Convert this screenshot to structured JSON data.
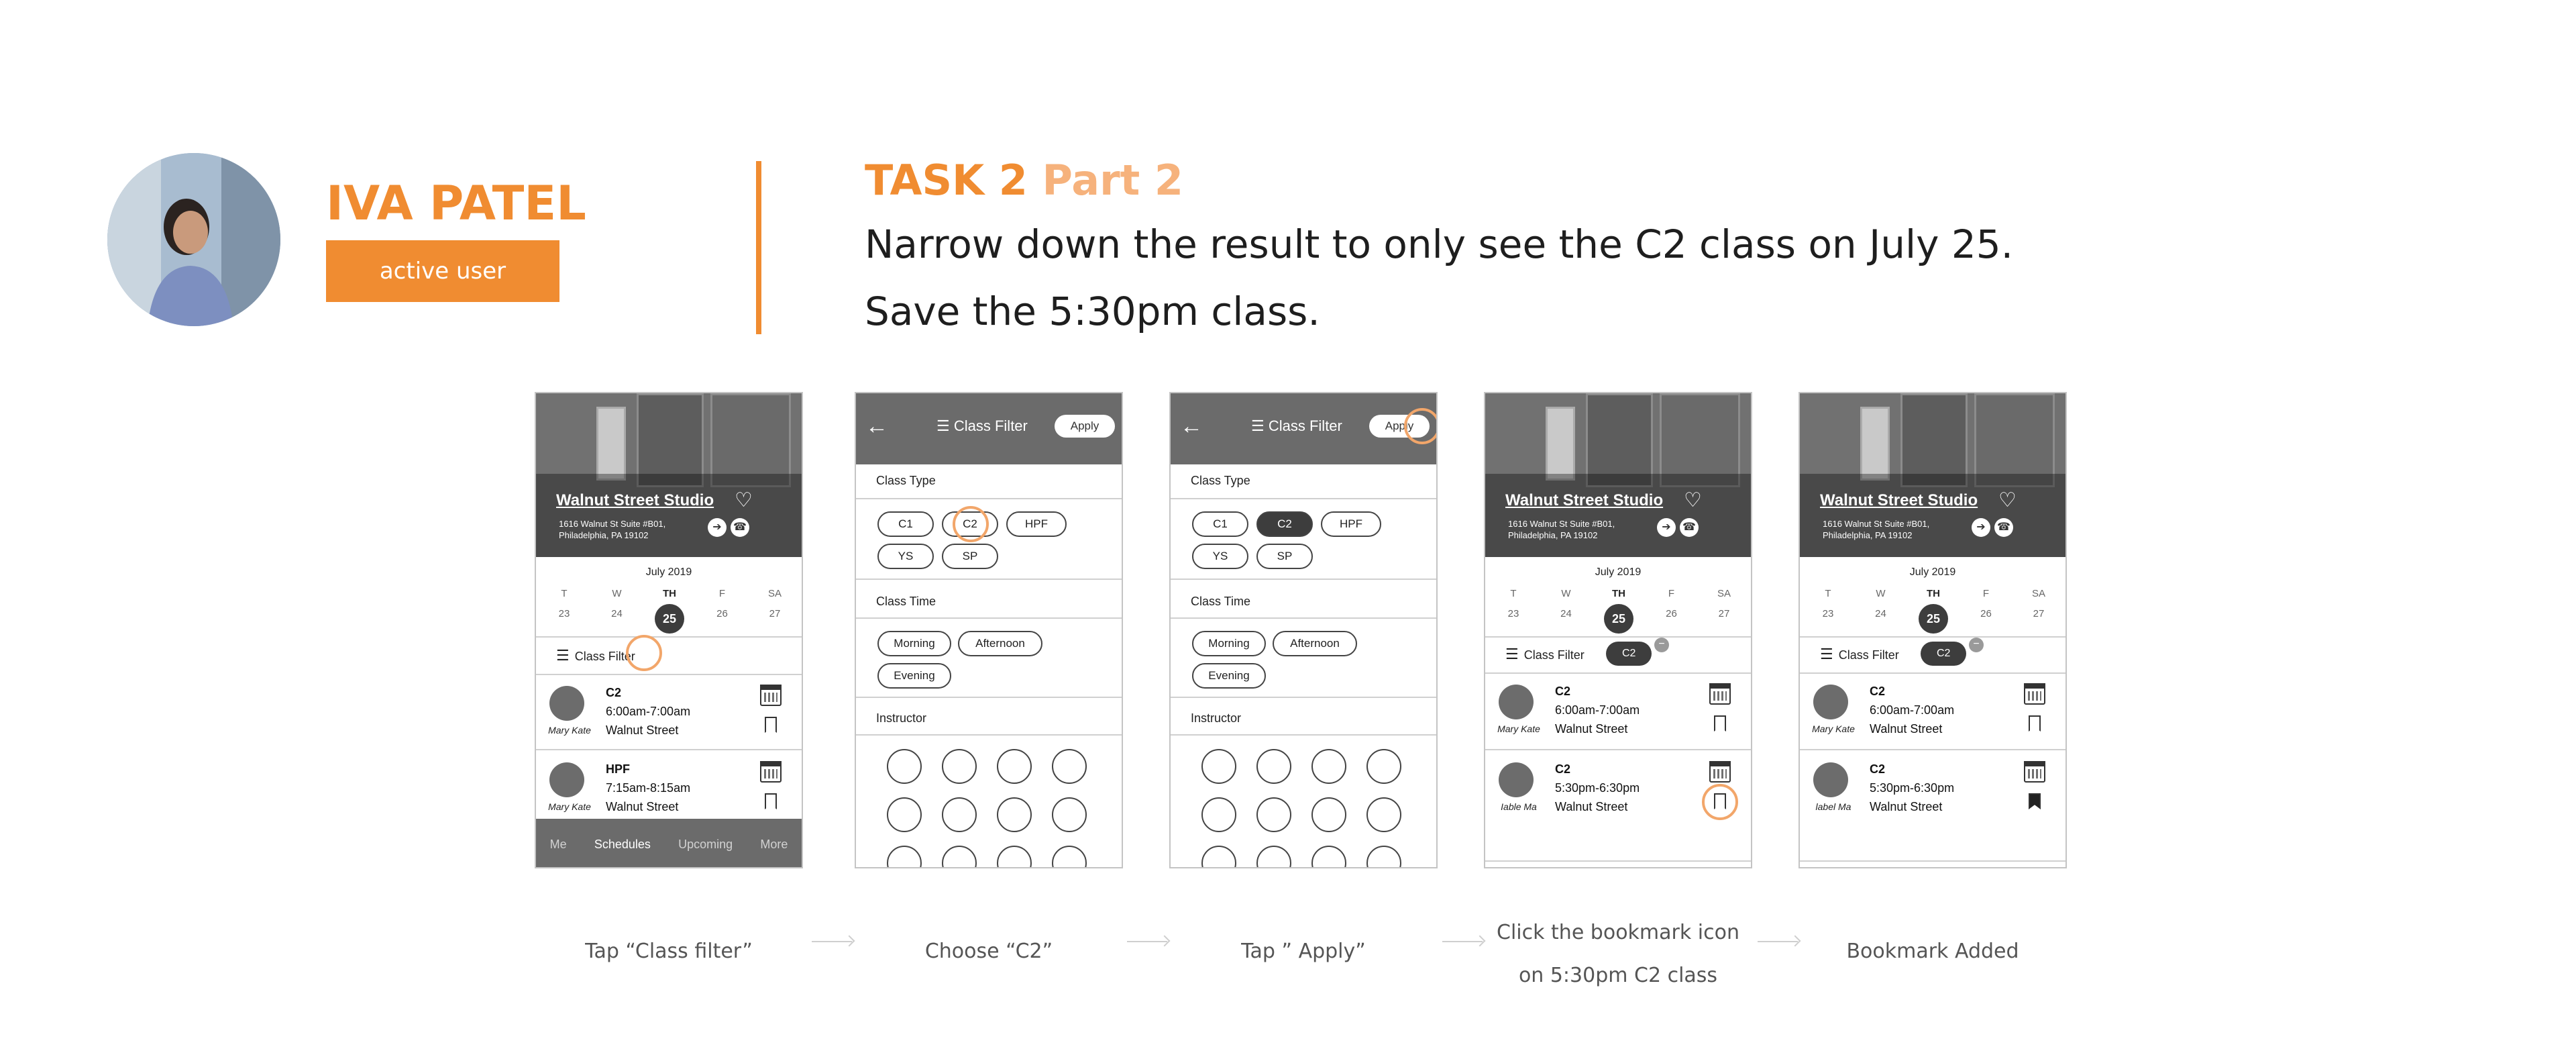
{
  "header": {
    "user_name": "IVA PATEL",
    "user_badge": "active user",
    "task_label": "TASK 2",
    "task_part": "Part 2",
    "instruction_line1": "Narrow down the result to only see the C2 class on July 25.",
    "instruction_line2": "Save the 5:30pm class."
  },
  "accent_color": "#f08c31",
  "app": {
    "studio_name": "Walnut Street Studio",
    "address": "1616 Walnut St Suite #B01,\nPhiladelphia, PA 19102",
    "month": "July 2019",
    "days": [
      {
        "label": "T",
        "num": "23"
      },
      {
        "label": "W",
        "num": "24"
      },
      {
        "label": "TH",
        "num": "25"
      },
      {
        "label": "F",
        "num": "26"
      },
      {
        "label": "SA",
        "num": "27"
      }
    ],
    "class_filter_label": "Class Filter",
    "filter_chip": "C2",
    "nav": [
      "Me",
      "Schedules",
      "Upcoming",
      "More"
    ],
    "classes_all": [
      {
        "name": "C2",
        "time": "6:00am-7:00am",
        "location": "Walnut Street",
        "instructor": "Mary Kate"
      },
      {
        "name": "HPF",
        "time": "7:15am-8:15am",
        "location": "Walnut Street",
        "instructor": "Mary Kate"
      }
    ],
    "classes_filtered": [
      {
        "name": "C2",
        "time": "6:00am-7:00am",
        "location": "Walnut Street",
        "instructor": "Mary Kate"
      },
      {
        "name": "C2",
        "time": "5:30pm-6:30pm",
        "location": "Walnut Street",
        "instructor_s4": "Iable Ma",
        "instructor_s5": "label Ma"
      }
    ]
  },
  "filter_screen": {
    "title": "Class Filter",
    "apply_label": "Apply",
    "class_type_label": "Class Type",
    "class_types": [
      "C1",
      "C2",
      "HPF",
      "YS",
      "SP"
    ],
    "class_time_label": "Class Time",
    "class_times": [
      "Morning",
      "Afternoon",
      "Evening"
    ],
    "instructor_label": "Instructor"
  },
  "steps": [
    {
      "caption": "Tap “Class filter”"
    },
    {
      "caption": "Choose “C2”"
    },
    {
      "caption": "Tap ” Apply”"
    },
    {
      "caption_line1": "Click the bookmark icon",
      "caption_line2": "on 5:30pm C2 class"
    },
    {
      "caption": "Bookmark Added"
    }
  ]
}
